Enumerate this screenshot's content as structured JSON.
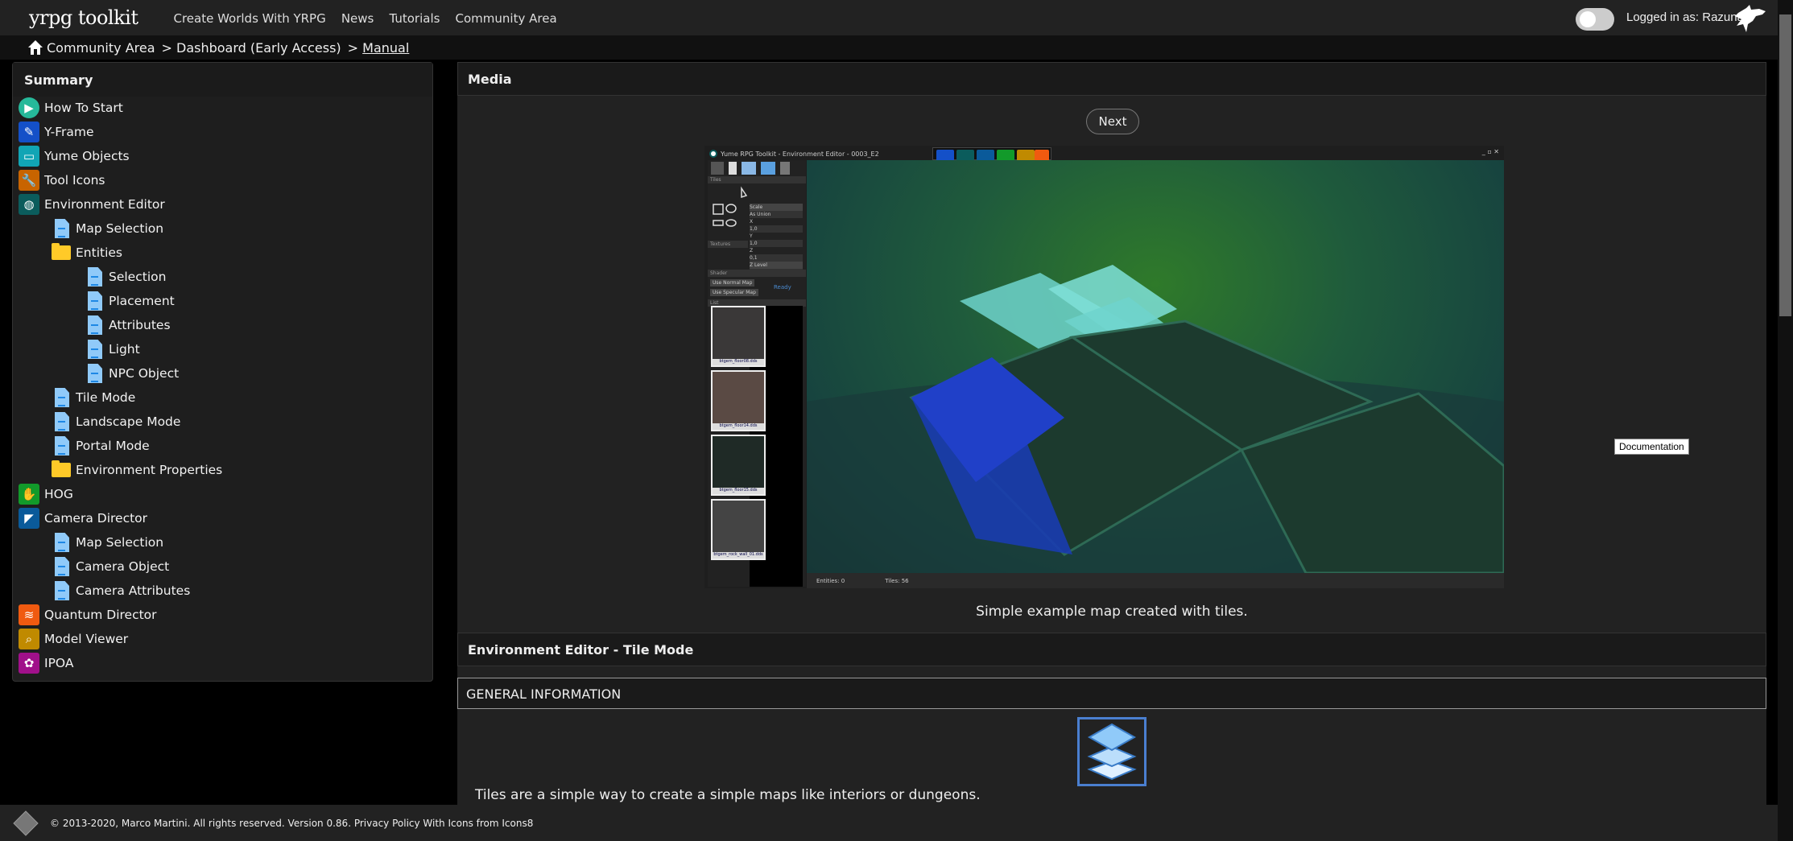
{
  "header": {
    "logo": "yrpg toolkit",
    "nav": [
      "Create Worlds With YRPG",
      "News",
      "Tutorials",
      "Community Area"
    ],
    "login": "Logged in as: Razuna",
    "toggle_on": false
  },
  "breadcrumb": [
    "Community Area",
    "> Dashboard (Early Access)",
    "> Manual"
  ],
  "sidebar": {
    "title": "Summary",
    "items": [
      {
        "label": "How To Start",
        "level": 0,
        "icon": "play-icon",
        "color": "#26b99a"
      },
      {
        "label": "Y-Frame",
        "level": 0,
        "icon": "book-icon",
        "color": "#1450c8"
      },
      {
        "label": "Yume Objects",
        "level": 0,
        "icon": "chest-icon",
        "color": "#11a5b5"
      },
      {
        "label": "Tool Icons",
        "level": 0,
        "icon": "wrench-icon",
        "color": "#c86400"
      },
      {
        "label": "Environment Editor",
        "level": 0,
        "icon": "globe-icon",
        "color": "#0b5c5c"
      },
      {
        "label": "Map Selection",
        "level": 1,
        "icon": "document-icon"
      },
      {
        "label": "Entities",
        "level": 1,
        "icon": "folder-icon"
      },
      {
        "label": "Selection",
        "level": 2,
        "icon": "document-icon"
      },
      {
        "label": "Placement",
        "level": 2,
        "icon": "document-icon"
      },
      {
        "label": "Attributes",
        "level": 2,
        "icon": "document-icon"
      },
      {
        "label": "Light",
        "level": 2,
        "icon": "document-icon"
      },
      {
        "label": "NPC Object",
        "level": 2,
        "icon": "document-icon"
      },
      {
        "label": "Tile Mode",
        "level": 1,
        "icon": "document-icon"
      },
      {
        "label": "Landscape Mode",
        "level": 1,
        "icon": "document-icon"
      },
      {
        "label": "Portal Mode",
        "level": 1,
        "icon": "document-icon"
      },
      {
        "label": "Environment Properties",
        "level": 1,
        "icon": "folder-icon"
      },
      {
        "label": "HOG",
        "level": 0,
        "icon": "plant-hand-icon",
        "color": "#129a2a"
      },
      {
        "label": "Camera Director",
        "level": 0,
        "icon": "camera-icon",
        "color": "#0a5a9a"
      },
      {
        "label": "Map Selection",
        "level": 1,
        "icon": "document-icon"
      },
      {
        "label": "Camera Object",
        "level": 1,
        "icon": "document-icon"
      },
      {
        "label": "Camera Attributes",
        "level": 1,
        "icon": "document-icon"
      },
      {
        "label": "Quantum Director",
        "level": 0,
        "icon": "waves-icon",
        "color": "#f05a10"
      },
      {
        "label": "Model Viewer",
        "level": 0,
        "icon": "magnifier-icon",
        "color": "#c08a00"
      },
      {
        "label": "IPOA",
        "level": 0,
        "icon": "palette-icon",
        "color": "#a0108a"
      }
    ]
  },
  "media": {
    "title": "Media",
    "next_label": "Next",
    "caption": "Simple example map created with tiles.",
    "tooltip": "Documentation",
    "editor": {
      "title": "Yume RPG Toolkit - Environment Editor - 0003_E2",
      "tiles_label": "Tiles",
      "scale_label": "Scale",
      "as_union": "As Union",
      "x_label": "X",
      "x": "1,0",
      "y_label": "Y",
      "y": "1,0",
      "z_label": "Z",
      "z": "0,1",
      "zlevel_label": "Z Level",
      "zlevel": "0",
      "textures_label": "Textures",
      "shader_label": "Shader",
      "normal_map": "Use Normal Map",
      "specular_map": "Use Specular Map",
      "ready": "Ready",
      "list_label": "List",
      "thumbs": [
        "btgem_floor08.dds",
        "btgem_floor14.dds",
        "btgem_floor15.dds",
        "btgem_rock_wall_01.dds"
      ],
      "entities": "Entities: 0",
      "tiles_count": "Tiles: 56"
    }
  },
  "section": {
    "title": "Environment Editor - Tile Mode",
    "general": "GENERAL INFORMATION",
    "text": "Tiles are a simple way to create a simple maps like interiors or dungeons."
  },
  "footer": {
    "text": "© 2013-2020, Marco Martini. All rights reserved. Version 0.86. Privacy Policy With Icons from Icons8"
  }
}
